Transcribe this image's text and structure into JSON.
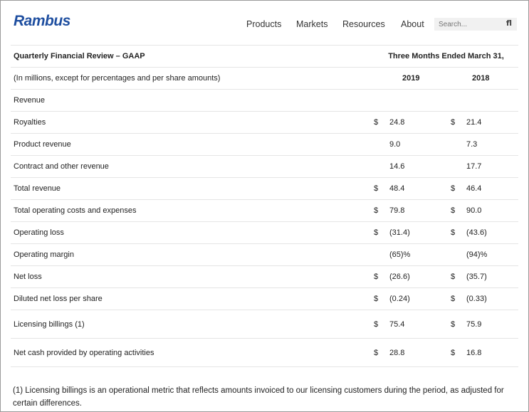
{
  "header": {
    "logo": "Rambus",
    "nav": [
      "Products",
      "Markets",
      "Resources",
      "About"
    ],
    "search_placeholder": "Search...",
    "search_icon": "fl"
  },
  "table": {
    "title": "Quarterly Financial Review – GAAP",
    "period_header": "Three Months Ended March 31,",
    "units_note": "(In millions, except for percentages and per share amounts)",
    "year_2019": "2019",
    "year_2018": "2018",
    "section": "Revenue",
    "rows": [
      {
        "label": "Royalties",
        "c19": "$",
        "v19": "24.8",
        "c18": "$",
        "v18": "21.4"
      },
      {
        "label": "Product revenue",
        "c19": "",
        "v19": "9.0",
        "c18": "",
        "v18": "7.3"
      },
      {
        "label": "Contract and other revenue",
        "c19": "",
        "v19": "14.6",
        "c18": "",
        "v18": "17.7"
      },
      {
        "label": "Total revenue",
        "c19": "$",
        "v19": "48.4",
        "c18": "$",
        "v18": "46.4"
      },
      {
        "label": "Total operating costs and expenses",
        "c19": "$",
        "v19": "79.8",
        "c18": "$",
        "v18": "90.0"
      },
      {
        "label": "Operating loss",
        "c19": "$",
        "v19": "(31.4)",
        "c18": "$",
        "v18": "(43.6)"
      },
      {
        "label": "Operating margin",
        "c19": "",
        "v19": "(65)%",
        "c18": "",
        "v18": "(94)%"
      },
      {
        "label": "Net loss",
        "c19": "$",
        "v19": "(26.6)",
        "c18": "$",
        "v18": "(35.7)"
      },
      {
        "label": "Diluted net loss per share",
        "c19": "$",
        "v19": "(0.24)",
        "c18": "$",
        "v18": "(0.33)"
      },
      {
        "label": "Licensing billings (1)",
        "c19": "$",
        "v19": "75.4",
        "c18": "$",
        "v18": "75.9"
      },
      {
        "label": "Net cash provided by operating activities",
        "c19": "$",
        "v19": "28.8",
        "c18": "$",
        "v18": "16.8"
      }
    ]
  },
  "footnote": "(1) Licensing billings is an operational metric that reflects amounts invoiced to our licensing customers during the period, as adjusted for certain differences."
}
